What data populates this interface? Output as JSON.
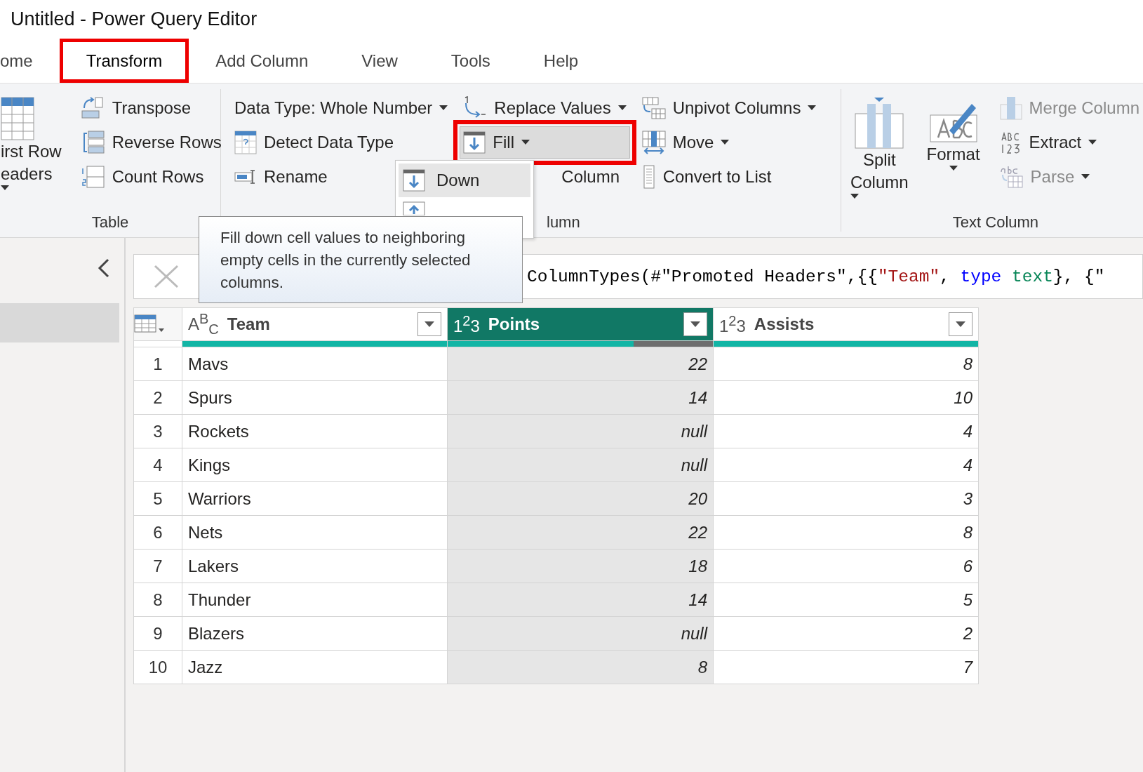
{
  "window": {
    "title": "Untitled - Power Query Editor"
  },
  "tabs": [
    {
      "label": "ome",
      "selected": false,
      "highlighted": false
    },
    {
      "label": "Transform",
      "selected": true,
      "highlighted": true
    },
    {
      "label": "Add Column",
      "selected": false,
      "highlighted": false
    },
    {
      "label": "View",
      "selected": false,
      "highlighted": false
    },
    {
      "label": "Tools",
      "selected": false,
      "highlighted": false
    },
    {
      "label": "Help",
      "selected": false,
      "highlighted": false
    }
  ],
  "ribbon": {
    "groups": [
      {
        "label": "Table",
        "columns": [
          [
            {
              "kind": "large",
              "lines": [
                "irst Row",
                "eaders"
              ],
              "dropdown": true,
              "disabled": false,
              "pressed": false,
              "highlighted": false
            }
          ],
          [
            {
              "kind": "small",
              "label": "Transpose",
              "dropdown": false,
              "disabled": false,
              "pressed": false,
              "highlighted": false
            },
            {
              "kind": "small",
              "label": "Reverse Rows",
              "dropdown": false,
              "disabled": false,
              "pressed": false,
              "highlighted": false
            },
            {
              "kind": "small",
              "label": "Count Rows",
              "dropdown": false,
              "disabled": false,
              "pressed": false,
              "highlighted": false
            }
          ]
        ]
      },
      {
        "label": "lumn",
        "columns": [
          [
            {
              "kind": "small",
              "label": "Data Type: Whole Number",
              "dropdown": true,
              "disabled": false,
              "pressed": false,
              "highlighted": false
            },
            {
              "kind": "small",
              "label": "Detect Data Type",
              "dropdown": false,
              "disabled": false,
              "pressed": false,
              "highlighted": false
            },
            {
              "kind": "small",
              "label": "Rename",
              "dropdown": false,
              "disabled": false,
              "pressed": false,
              "highlighted": false
            }
          ],
          [
            {
              "kind": "small",
              "label": "Replace Values",
              "dropdown": true,
              "disabled": false,
              "pressed": false,
              "highlighted": false
            },
            {
              "kind": "small",
              "label": "Fill",
              "dropdown": true,
              "disabled": false,
              "pressed": true,
              "highlighted": true
            },
            {
              "kind": "small",
              "label": "Column",
              "dropdown": false,
              "disabled": false,
              "pressed": false,
              "highlighted": false
            }
          ],
          [
            {
              "kind": "small",
              "label": "Unpivot Columns",
              "dropdown": true,
              "disabled": false,
              "pressed": false,
              "highlighted": false
            },
            {
              "kind": "small",
              "label": "Move",
              "dropdown": true,
              "disabled": false,
              "pressed": false,
              "highlighted": false
            },
            {
              "kind": "small",
              "label": "Convert to List",
              "dropdown": false,
              "disabled": false,
              "pressed": false,
              "highlighted": false
            }
          ]
        ]
      },
      {
        "label": "Text Column",
        "columns": [
          [
            {
              "kind": "large",
              "lines": [
                "Split",
                "Column"
              ],
              "dropdown": true,
              "disabled": false,
              "pressed": false,
              "highlighted": false
            }
          ],
          [
            {
              "kind": "large-stacked",
              "lines": [
                "Format"
              ],
              "dropdown": true,
              "disabled": false,
              "pressed": false,
              "highlighted": false
            }
          ],
          [
            {
              "kind": "small",
              "label": "Merge Column",
              "dropdown": false,
              "disabled": true,
              "pressed": false,
              "highlighted": false
            },
            {
              "kind": "small",
              "label": "Extract",
              "dropdown": true,
              "disabled": false,
              "pressed": false,
              "highlighted": false
            },
            {
              "kind": "small",
              "label": "Parse",
              "dropdown": true,
              "disabled": true,
              "pressed": false,
              "highlighted": false
            }
          ]
        ]
      }
    ]
  },
  "fill_menu": {
    "items": [
      {
        "label": "Down",
        "hovered": true
      }
    ]
  },
  "tooltip": {
    "text": "Fill down cell values to neighboring empty cells in the currently selected columns."
  },
  "formula": {
    "segments": [
      {
        "kind": "plain",
        "text": "ColumnTypes(#\"Promoted Headers\",{{"
      },
      {
        "kind": "string",
        "text": "\"Team\""
      },
      {
        "kind": "plain",
        "text": ", "
      },
      {
        "kind": "keyword",
        "text": "type"
      },
      {
        "kind": "type",
        "text": " text"
      },
      {
        "kind": "plain",
        "text": "}, {\""
      }
    ]
  },
  "table": {
    "columns": [
      {
        "name": "Team",
        "type_label": "A$^{B}$$_{C}$",
        "selected": false,
        "kind": "text",
        "quality": {
          "level": 1
        }
      },
      {
        "name": "Points",
        "type_label": "1$^{2}$3",
        "selected": true,
        "kind": "number",
        "quality": {
          "level": 0.7
        }
      },
      {
        "name": "Assists",
        "type_label": "1$^{2}$3",
        "selected": false,
        "kind": "number",
        "quality": {
          "level": 1
        }
      }
    ],
    "rows": [
      {
        "index": "1",
        "cells": [
          "Mavs",
          "22",
          "8"
        ]
      },
      {
        "index": "2",
        "cells": [
          "Spurs",
          "14",
          "10"
        ]
      },
      {
        "index": "3",
        "cells": [
          "Rockets",
          "null",
          "4"
        ]
      },
      {
        "index": "4",
        "cells": [
          "Kings",
          "null",
          "4"
        ]
      },
      {
        "index": "5",
        "cells": [
          "Warriors",
          "20",
          "3"
        ]
      },
      {
        "index": "6",
        "cells": [
          "Nets",
          "22",
          "8"
        ]
      },
      {
        "index": "7",
        "cells": [
          "Lakers",
          "18",
          "6"
        ]
      },
      {
        "index": "8",
        "cells": [
          "Thunder",
          "14",
          "5"
        ]
      },
      {
        "index": "9",
        "cells": [
          "Blazers",
          "null",
          "2"
        ]
      },
      {
        "index": "10",
        "cells": [
          "Jazz",
          "8",
          "7"
        ]
      }
    ]
  }
}
